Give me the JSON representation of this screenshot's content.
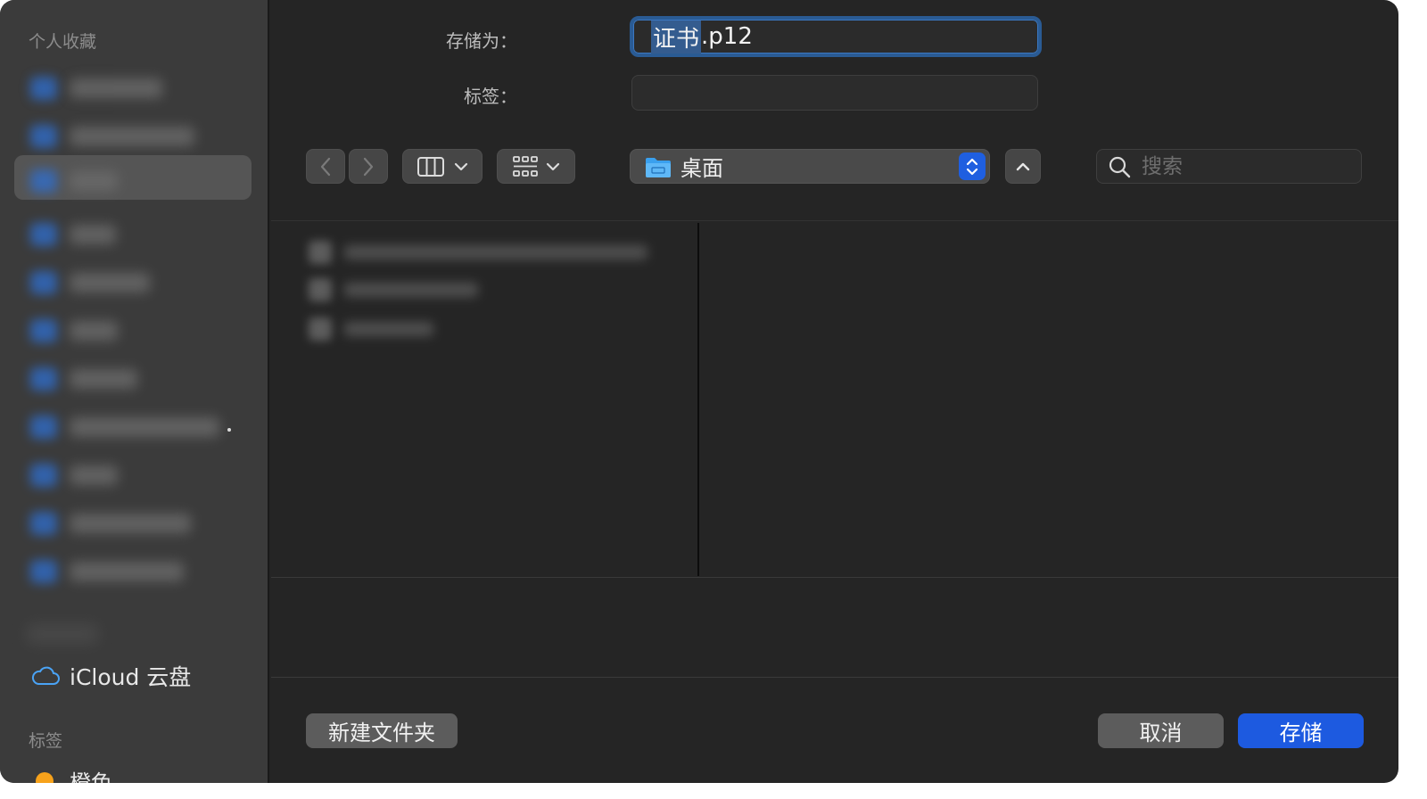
{
  "sidebar": {
    "favorites_header": "个人收藏",
    "tags_header": "标签",
    "icloud_label": "iCloud 云盘",
    "tag_item_label": "橙色",
    "colors": {
      "accent": "#2f6fd0",
      "tag_orange": "#f7a21b"
    }
  },
  "form": {
    "save_as_label": "存储为：",
    "filename_selected": "证书",
    "filename_rest": ".p12",
    "tags_label": "标签："
  },
  "toolbar": {
    "back_icon": "chevron-left-icon",
    "forward_icon": "chevron-right-icon",
    "view_mode_icon": "column-view-icon",
    "group_icon": "grid-group-icon",
    "location_label": "桌面",
    "search_placeholder": "搜索"
  },
  "footer": {
    "new_folder_label": "新建文件夹",
    "cancel_label": "取消",
    "save_label": "存储"
  }
}
